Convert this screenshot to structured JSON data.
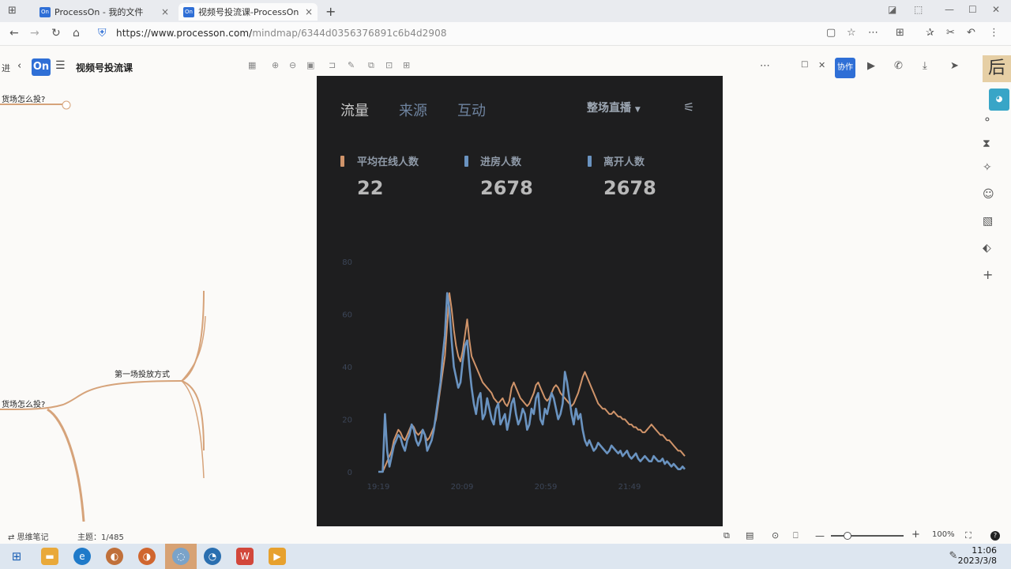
{
  "browser": {
    "tabs": [
      {
        "label": "ProcessOn - 我的文件",
        "favicon": "On"
      },
      {
        "label": "视频号投流课-ProcessOn",
        "favicon": "On"
      }
    ],
    "url_main": "https://www.processon.com/",
    "url_path": "mindmap/6344d0356376891c6b4d2908"
  },
  "app": {
    "logo": "On",
    "doc_title": "视频号投流课",
    "share_chip": "协作"
  },
  "mindmap": {
    "nodes": [
      "货场怎么投?",
      "第一场投放方式",
      "货场怎么投?"
    ]
  },
  "panel": {
    "tabs": [
      "流量",
      "来源",
      "互动"
    ],
    "active_tab": "流量",
    "dropdown": "整场直播",
    "metrics": [
      {
        "label": "平均在线人数",
        "value": "22",
        "color": "#d0946a"
      },
      {
        "label": "进房人数",
        "value": "2678",
        "color": "#6a93c0"
      },
      {
        "label": "离开人数",
        "value": "2678",
        "color": "#6a93c0"
      }
    ]
  },
  "chart_data": {
    "type": "line",
    "x_ticks": [
      "19:19",
      "20:09",
      "20:59",
      "21:49"
    ],
    "y_ticks": [
      0,
      20,
      40,
      60,
      80
    ],
    "ylim": [
      0,
      80
    ],
    "series": [
      {
        "color": "#d0946a",
        "values": [
          0,
          0,
          0,
          2,
          4,
          6,
          8,
          12,
          14,
          16,
          15,
          13,
          12,
          14,
          16,
          18,
          17,
          15,
          14,
          15,
          16,
          14,
          12,
          13,
          15,
          17,
          20,
          26,
          32,
          38,
          44,
          56,
          68,
          62,
          54,
          48,
          44,
          42,
          46,
          52,
          58,
          50,
          44,
          42,
          40,
          38,
          36,
          34,
          33,
          32,
          31,
          30,
          28,
          27,
          26,
          27,
          28,
          26,
          25,
          27,
          32,
          34,
          32,
          30,
          28,
          27,
          26,
          25,
          26,
          28,
          30,
          33,
          34,
          32,
          30,
          28,
          27,
          28,
          30,
          32,
          33,
          32,
          30,
          29,
          28,
          27,
          26,
          25,
          26,
          28,
          30,
          33,
          36,
          38,
          36,
          34,
          32,
          30,
          28,
          26,
          25,
          24,
          24,
          23,
          22,
          22,
          23,
          22,
          21,
          21,
          20,
          20,
          19,
          18,
          18,
          17,
          17,
          16,
          16,
          15,
          15,
          16,
          17,
          18,
          17,
          16,
          15,
          14,
          14,
          13,
          12,
          12,
          11,
          10,
          9,
          8,
          8,
          7,
          6
        ]
      },
      {
        "color": "#6a93c0",
        "values": [
          0,
          0,
          0,
          22,
          8,
          2,
          6,
          10,
          12,
          14,
          13,
          10,
          8,
          12,
          14,
          18,
          16,
          12,
          10,
          12,
          16,
          14,
          8,
          10,
          12,
          16,
          22,
          28,
          34,
          44,
          52,
          68,
          62,
          50,
          40,
          36,
          32,
          34,
          42,
          48,
          50,
          40,
          32,
          26,
          22,
          28,
          30,
          20,
          22,
          28,
          24,
          20,
          18,
          24,
          26,
          18,
          20,
          22,
          16,
          20,
          26,
          28,
          22,
          18,
          20,
          24,
          22,
          16,
          18,
          24,
          22,
          28,
          30,
          20,
          18,
          24,
          22,
          26,
          30,
          28,
          24,
          20,
          22,
          26,
          38,
          34,
          28,
          22,
          18,
          24,
          20,
          22,
          16,
          12,
          10,
          12,
          10,
          8,
          9,
          11,
          10,
          9,
          8,
          7,
          8,
          10,
          9,
          8,
          7,
          8,
          6,
          7,
          8,
          6,
          5,
          6,
          7,
          5,
          4,
          5,
          6,
          5,
          4,
          4,
          6,
          5,
          4,
          4,
          5,
          3,
          4,
          3,
          2,
          3,
          2,
          1,
          1,
          2,
          1
        ]
      }
    ]
  },
  "statusbar": {
    "notes": "⇄ 思维笔记",
    "topic": "主题：1/485",
    "zoom": "100%"
  },
  "taskbar": {
    "time": "11:06",
    "date": "2023/3/8"
  }
}
